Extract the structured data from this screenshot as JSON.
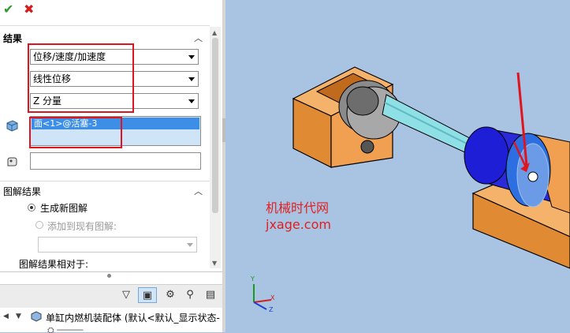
{
  "toolbar_top": {
    "ok_icon": "checkmark-icon",
    "cancel_icon": "close-icon"
  },
  "results": {
    "title": "结果",
    "dropdown1": "位移/速度/加速度",
    "dropdown2": "线性位移",
    "dropdown3": "Z 分量",
    "selection_item": "面<1>@活塞-3"
  },
  "plot": {
    "title": "图解结果",
    "option_new": "生成新图解",
    "option_add": "添加到现有图解:",
    "relative_label": "图解结果相对于:"
  },
  "tree": {
    "root_label": "单缸内燃机装配体  (默认<默认_显示状态-"
  },
  "watermark": {
    "line1": "机械时代网",
    "line2": "jxage.com"
  },
  "triad": {
    "x": "X",
    "y": "Y",
    "z": "Z"
  },
  "colors": {
    "highlight": "#e0141e",
    "selection": "#3d8ee6",
    "viewport_bg": "#a9c3e3"
  }
}
